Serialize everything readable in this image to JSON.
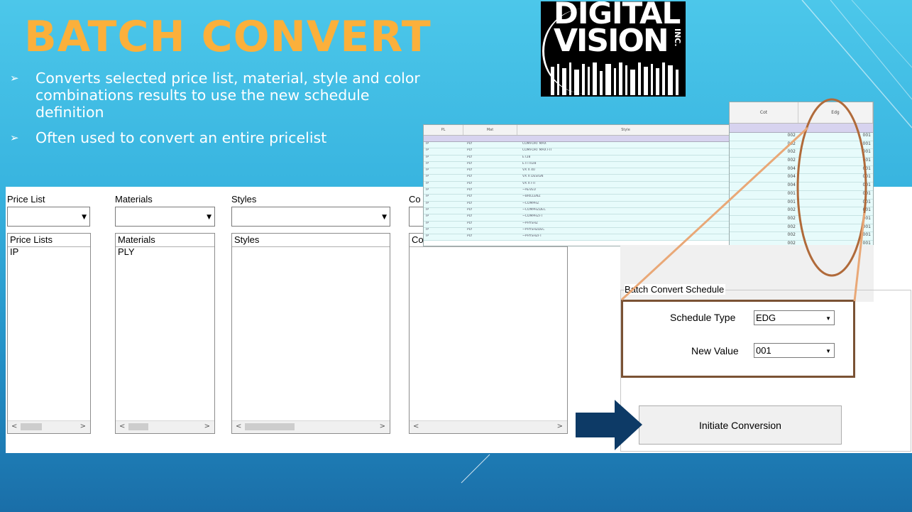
{
  "slide": {
    "title": "BATCH CONVERT",
    "bullets": [
      "Converts selected price list, material, style and color combinations results to use the new schedule definition",
      "Often used to convert an entire pricelist"
    ],
    "bullet_marker": "➢",
    "logo": {
      "line1": "DIGITAL",
      "line2": "VISION",
      "suffix": "INC."
    },
    "title_color": "#fbb03b",
    "arrow_color": "#0d3a66",
    "callout_color": "#b06a3a"
  },
  "lists": [
    {
      "label": "Price List",
      "header": "Price Lists",
      "items": [
        "IP"
      ],
      "scroll_left": "<",
      "scroll_right": ">"
    },
    {
      "label": "Materials",
      "header": "Materials",
      "items": [
        "PLY"
      ],
      "scroll_left": "<",
      "scroll_right": ">"
    },
    {
      "label": "Styles",
      "header": "Styles",
      "items": [],
      "scroll_left": "<",
      "scroll_right": ">"
    },
    {
      "label": "Co",
      "header": "Co",
      "items": [],
      "scroll_left": "<",
      "scroll_right": ">"
    }
  ],
  "grid_styles": {
    "columns": [
      "PL",
      "Mat",
      "",
      "Style"
    ],
    "rows": [
      [
        "IP",
        "PLY",
        "COMFORT MAX"
      ],
      [
        "IP",
        "PLY",
        "COMFORT MAX FIT"
      ],
      [
        "IP",
        "PLY",
        "ET28"
      ],
      [
        "IP",
        "PLY",
        "ETTT028"
      ],
      [
        "IP",
        "PLY",
        "VX X 40"
      ],
      [
        "IP",
        "PLY",
        "VX X DESIGN"
      ],
      [
        "IP",
        "PLY",
        "VX X FIT"
      ],
      [
        "IP",
        "PLY",
        "~AEVEU"
      ],
      [
        "IP",
        "PLY",
        "~BRILLENZ"
      ],
      [
        "IP",
        "PLY",
        "~COMPHZ"
      ],
      [
        "IP",
        "PLY",
        "~COMPHZDEC"
      ],
      [
        "IP",
        "PLY",
        "~COMPHZFT"
      ],
      [
        "IP",
        "PLY",
        "~PHYSHZ"
      ],
      [
        "IP",
        "PLY",
        "~PHYSHZDEC"
      ],
      [
        "IP",
        "PLY",
        "~PHYSHZFT"
      ]
    ]
  },
  "grid_schedule": {
    "columns": [
      "Cot",
      "Edg"
    ],
    "rows": [
      [
        "002",
        "001"
      ],
      [
        "002",
        "001"
      ],
      [
        "002",
        "001"
      ],
      [
        "002",
        "001"
      ],
      [
        "004",
        "001"
      ],
      [
        "004",
        "001"
      ],
      [
        "004",
        "001"
      ],
      [
        "001",
        "001"
      ],
      [
        "001",
        "001"
      ],
      [
        "002",
        "001"
      ],
      [
        "002",
        "001"
      ],
      [
        "002",
        "001"
      ],
      [
        "002",
        "001"
      ],
      [
        "002",
        "001"
      ],
      [
        "002",
        "001"
      ]
    ]
  },
  "batch": {
    "group_title": "Batch Convert Schedule",
    "schedule_type_label": "Schedule Type",
    "schedule_type_value": "EDG",
    "new_value_label": "New Value",
    "new_value_value": "001",
    "dropdown_arrow": "▼",
    "initiate_label": "Initiate Conversion"
  }
}
